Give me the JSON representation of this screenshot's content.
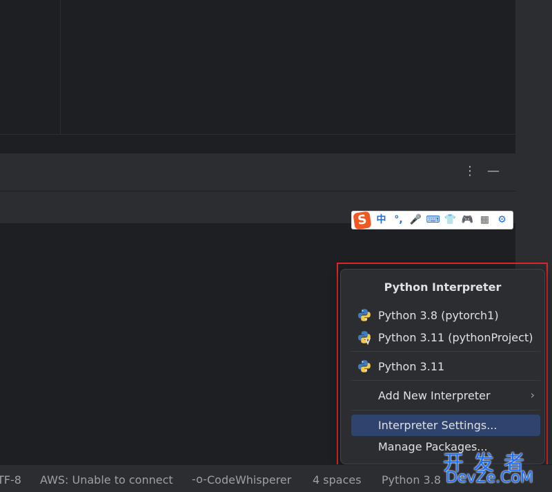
{
  "tool_window": {
    "more_icon": "⋮",
    "minimize_icon": "—"
  },
  "ime_toolbar": {
    "logo": "S",
    "items": [
      "中",
      "°,",
      "🎤",
      "⌨",
      "👕",
      "🎮",
      "▦",
      "⚙"
    ]
  },
  "popup": {
    "title": "Python Interpreter",
    "interpreters": [
      {
        "label": "Python 3.8 (pytorch1)",
        "icon": "python-icon"
      },
      {
        "label": "Python 3.11 (pythonProject)",
        "icon": "python-venv-icon"
      },
      {
        "label": "Python 3.11",
        "icon": "python-icon"
      }
    ],
    "add_new": "Add New Interpreter",
    "settings": "Interpreter Settings...",
    "manage": "Manage Packages..."
  },
  "status_bar": {
    "encoding": "TF-8",
    "aws": "AWS: Unable to connect",
    "codewhisperer_icon": "-o-",
    "codewhisperer": "CodeWhisperer",
    "indent": "4 spaces",
    "interpreter": "Python 3.8"
  },
  "watermark": {
    "cn": "开发者",
    "en": "DevZe.CoM"
  },
  "colors": {
    "selection": "#2e436e",
    "highlight_frame": "#e0262a",
    "watermark": "#1a6fff",
    "ime_accent": "#1f6bd6"
  }
}
